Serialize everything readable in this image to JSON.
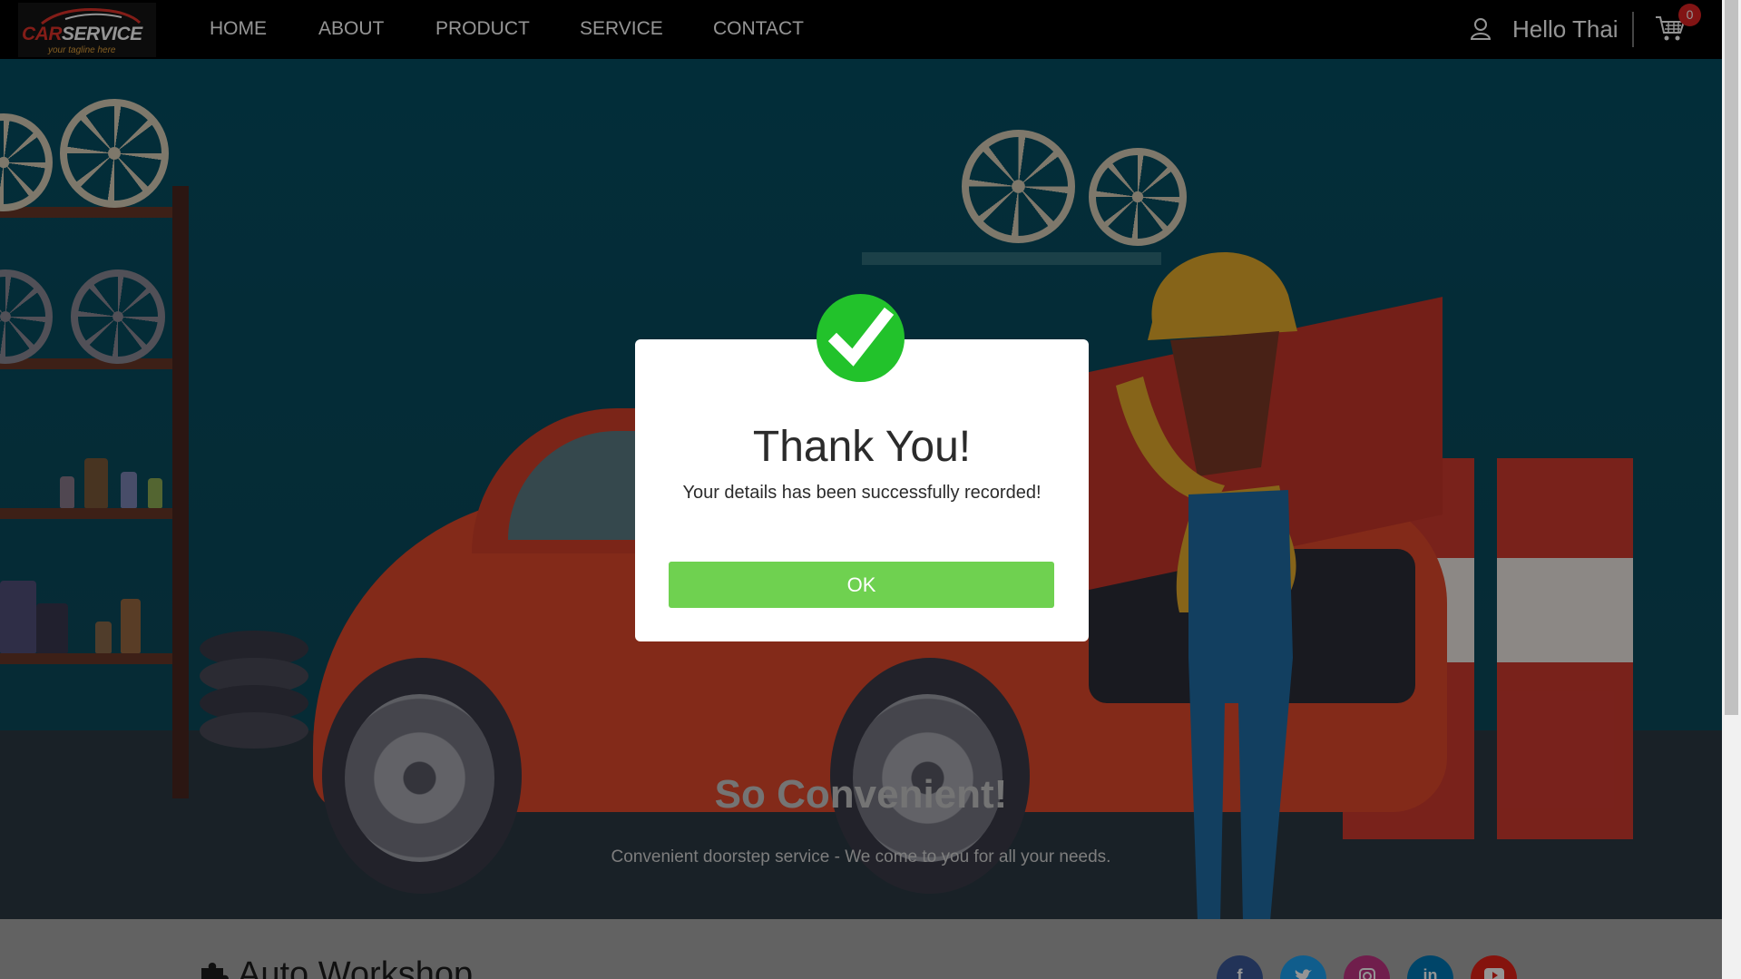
{
  "brand": {
    "name_part1": "CAR",
    "name_part2": "SERVICE",
    "tagline": "your tagline here"
  },
  "nav": {
    "items": [
      {
        "label": "HOME"
      },
      {
        "label": "ABOUT"
      },
      {
        "label": "PRODUCT"
      },
      {
        "label": "SERVICE"
      },
      {
        "label": "CONTACT"
      }
    ],
    "greeting": "Hello Thai",
    "cart_count": "0"
  },
  "hero": {
    "title": "So Convenient!",
    "subtitle": "Convenient doorstep service - We come to you for all your needs."
  },
  "footer": {
    "brand": "Auto Workshop",
    "social": [
      {
        "label": "f",
        "icon": "facebook-icon",
        "color": "#3b5998"
      },
      {
        "label": "t",
        "icon": "twitter-icon",
        "color": "#1da1f2"
      },
      {
        "label": "ig",
        "icon": "instagram-icon",
        "color": "#c13584"
      },
      {
        "label": "in",
        "icon": "linkedin-icon",
        "color": "#0077b5"
      },
      {
        "label": "yt",
        "icon": "youtube-icon",
        "color": "#e62117"
      }
    ]
  },
  "modal": {
    "title": "Thank You!",
    "message": "Your details has been successfully recorded!",
    "ok_label": "OK",
    "icon": "checkmark-icon",
    "accent": "#22c22b",
    "button_color": "#6fd150"
  }
}
